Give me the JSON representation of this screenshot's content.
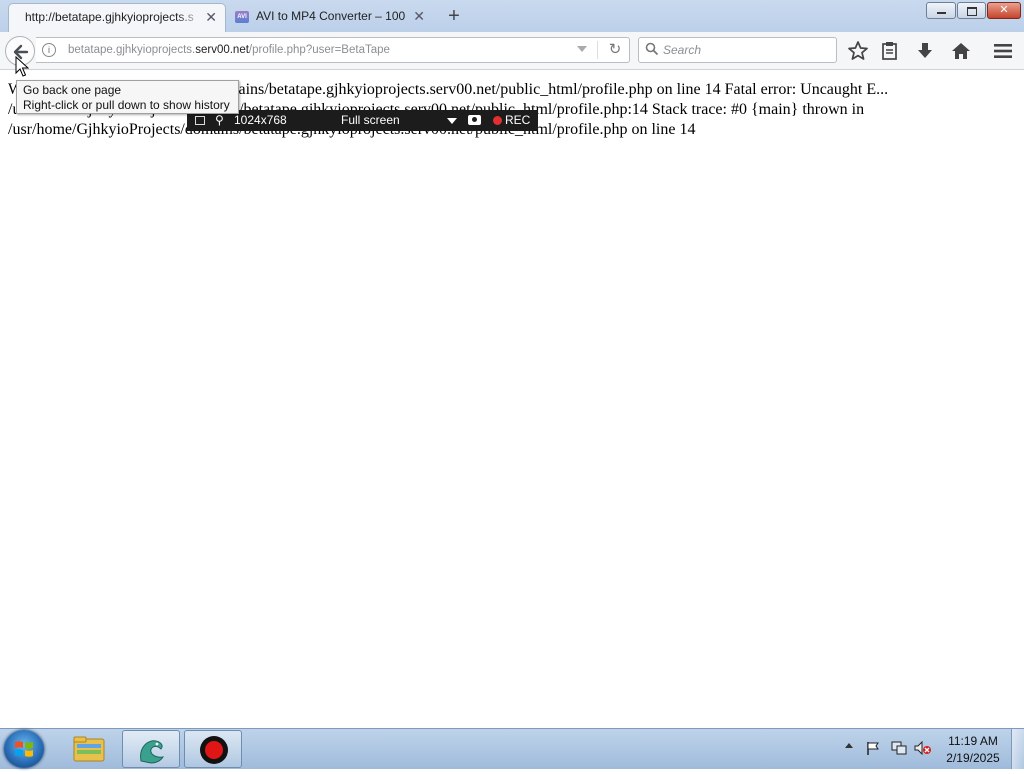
{
  "browser": {
    "tabs": [
      {
        "title": "http://betatape.gjhkyioprojects.s",
        "active": true
      },
      {
        "title": "AVI to MP4 Converter – 100",
        "active": false,
        "favicon_text": "AVI"
      }
    ],
    "new_tab_glyph": "+",
    "url": {
      "prefix": "betatape.gjhkyioprojects.",
      "host": "serv00.net",
      "path": "/profile.php?user=BetaTape"
    },
    "search_placeholder": "Search"
  },
  "page": {
    "error_text": "W... usr/home/GjhkyioProjects/domains/betatape.gjhkyioprojects.serv00.net/public_html/profile.php on line 14 Fatal error: Uncaught E... /usr/home/GjhkyioProjects/domains/betatape.gjhkyioprojects.serv00.net/public_html/profile.php:14 Stack trace: #0 {main} thrown in /usr/home/GjhkyioProjects/domains/betatape.gjhkyioprojects.serv00.net/public_html/profile.php on line 14"
  },
  "tooltip": {
    "line1": "Go back one page",
    "line2": "Right-click or pull down to show history"
  },
  "recorder": {
    "size": "1024x768",
    "mode": "Full screen",
    "rec_label": "REC"
  },
  "taskbar": {
    "time": "11:19 AM",
    "date": "2/19/2025"
  },
  "colors": {
    "titlebar": "#bcd0ea",
    "taskbar": "#9fbbdb",
    "rec_dot": "#e23030"
  }
}
